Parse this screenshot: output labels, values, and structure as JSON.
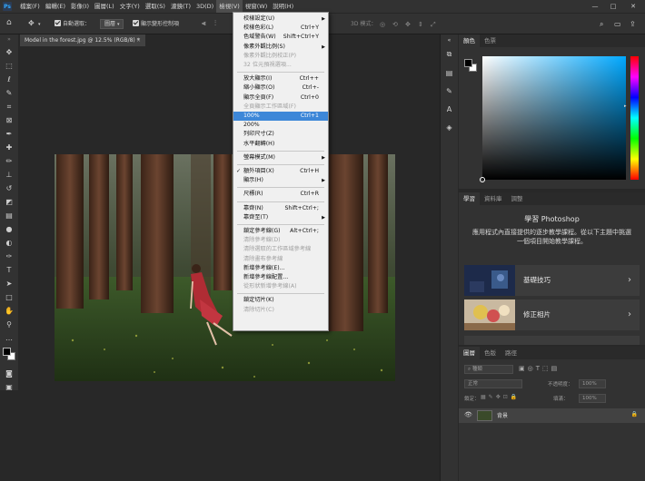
{
  "app": {
    "logo": "Ps"
  },
  "menubar": [
    "檔案(F)",
    "編輯(E)",
    "影像(I)",
    "圖層(L)",
    "文字(Y)",
    "選取(S)",
    "濾鏡(T)",
    "3D(D)",
    "檢視(V)",
    "視窗(W)",
    "說明(H)"
  ],
  "window_controls": [
    "—",
    "□",
    "✕"
  ],
  "options_bar": {
    "auto_select_label": "自動選取：",
    "auto_select_value": "圖層",
    "transform_label": "顯示變形控制項",
    "mode_3d_label": "3D 模式："
  },
  "document_tab": {
    "title": "Model in the forest.jpg @ 12.5% (RGB/8) *",
    "close": "×"
  },
  "view_menu": {
    "items": [
      {
        "label": "校樣設定(U)",
        "arrow": true
      },
      {
        "label": "校樣色彩(L)",
        "shortcut": "Ctrl+Y"
      },
      {
        "label": "色域警告(W)",
        "shortcut": "Shift+Ctrl+Y"
      },
      {
        "label": "像素外觀比例(S)",
        "arrow": true
      },
      {
        "label": "像素外觀比例校正(P)",
        "disabled": true
      },
      {
        "label": "32 位元預視選項...",
        "disabled": true
      },
      {
        "sep": true
      },
      {
        "label": "放大顯示(I)",
        "shortcut": "Ctrl++"
      },
      {
        "label": "縮小顯示(O)",
        "shortcut": "Ctrl+-"
      },
      {
        "label": "顯示全頁(F)",
        "shortcut": "Ctrl+0"
      },
      {
        "label": "全頁顯示工作區域(F)",
        "disabled": true
      },
      {
        "label": "100%",
        "shortcut": "Ctrl+1",
        "highlight": true
      },
      {
        "label": "200%"
      },
      {
        "label": "列印尺寸(Z)"
      },
      {
        "label": "水平翻轉(H)"
      },
      {
        "sep": true
      },
      {
        "label": "螢幕模式(M)",
        "arrow": true
      },
      {
        "sep": true
      },
      {
        "label": "額外項目(X)",
        "shortcut": "Ctrl+H",
        "checked": true
      },
      {
        "label": "顯示(H)",
        "arrow": true
      },
      {
        "sep": true
      },
      {
        "label": "尺標(R)",
        "shortcut": "Ctrl+R"
      },
      {
        "sep": true
      },
      {
        "label": "靠齊(N)",
        "shortcut": "Shift+Ctrl+;"
      },
      {
        "label": "靠齊至(T)",
        "arrow": true
      },
      {
        "sep": true
      },
      {
        "label": "鎖定參考線(G)",
        "shortcut": "Alt+Ctrl+;"
      },
      {
        "label": "清除參考線(D)",
        "disabled": true
      },
      {
        "label": "清除選取的工作區域參考線",
        "disabled": true
      },
      {
        "label": "清除畫布參考線",
        "disabled": true
      },
      {
        "label": "新增參考線(E)..."
      },
      {
        "label": "新增參考線配置..."
      },
      {
        "label": "從形狀新增參考線(A)",
        "disabled": true
      },
      {
        "sep": true
      },
      {
        "label": "鎖定切片(K)"
      },
      {
        "label": "清除切片(C)",
        "disabled": true
      }
    ]
  },
  "color_panel": {
    "tabs": [
      "顏色",
      "色票"
    ]
  },
  "learn_panel": {
    "tabs": [
      "學習",
      "資料庫",
      "調整"
    ],
    "title": "學習 Photoshop",
    "desc": "應用程式內直接提供的逐步教學課程。從以下主題中挑選一個項目開始教學課程。",
    "cards": [
      {
        "label": "基礎技巧",
        "chevron": "›"
      },
      {
        "label": "修正相片",
        "chevron": "›"
      }
    ]
  },
  "layers_panel": {
    "tabs": [
      "圖層",
      "色版",
      "路徑"
    ],
    "kind_placeholder": "種類",
    "blend_mode": "正常",
    "opacity_label": "不透明度：",
    "opacity_value": "100%",
    "lock_label": "鎖定：",
    "fill_label": "填滿：",
    "fill_value": "100%",
    "layer_name": "背景"
  }
}
